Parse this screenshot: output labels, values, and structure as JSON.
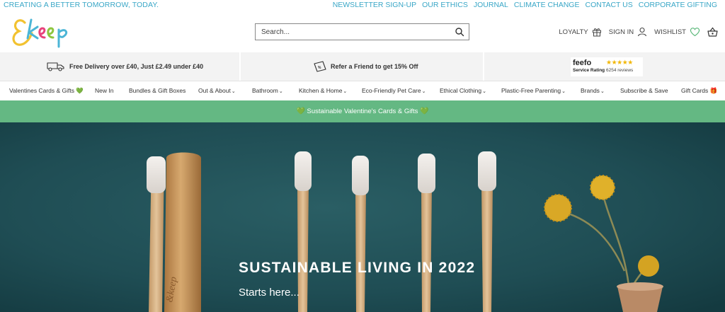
{
  "topbar": {
    "tagline": "CREATING A BETTER TOMORROW, TODAY.",
    "links": [
      "NEWSLETTER SIGN-UP",
      "OUR ETHICS",
      "JOURNAL",
      "CLIMATE CHANGE",
      "CONTACT US",
      "CORPORATE GIFTING"
    ]
  },
  "header": {
    "logo_text": "&keep",
    "search_placeholder": "Search...",
    "loyalty": "LOYALTY",
    "sign_in": "SIGN IN",
    "wishlist": "WISHLIST"
  },
  "usp": {
    "delivery": "Free Delivery over £40, Just £2.49 under £40",
    "refer": "Refer a Friend to get 15% Off",
    "feefo_logo": "feefo",
    "feefo_rating": "Service Rating",
    "feefo_reviews": "6254 reviews"
  },
  "nav": {
    "items": [
      {
        "label": "Valentines Cards & Gifts",
        "suffix": "💚"
      },
      {
        "label": "New In"
      },
      {
        "label": "Bundles & Gift Boxes"
      },
      {
        "label": "Out & About",
        "chevron": "⌄"
      },
      {
        "label": "Bathroom",
        "chevron": "⌄"
      },
      {
        "label": "Kitchen & Home",
        "chevron": "⌄"
      },
      {
        "label": "Eco-Friendly Pet Care",
        "chevron": "⌄"
      },
      {
        "label": "Ethical Clothing",
        "chevron": "⌄"
      },
      {
        "label": "Plastic-Free Parenting",
        "chevron": "⌄"
      },
      {
        "label": "Brands",
        "chevron": "⌄"
      },
      {
        "label": "Subscribe & Save"
      },
      {
        "label": "Gift Cards",
        "suffix": "🎁"
      }
    ]
  },
  "promo": {
    "text": "Sustainable Valentine's Cards & Gifts",
    "icon": "green-heart"
  },
  "hero": {
    "title": "SUSTAINABLE LIVING IN 2022",
    "subtitle": "Starts here...",
    "brush_stamp": "&keep"
  },
  "colors": {
    "accent": "#3aa7c7",
    "promo_green": "#64b883",
    "hero_bg": "#1f4e55"
  }
}
